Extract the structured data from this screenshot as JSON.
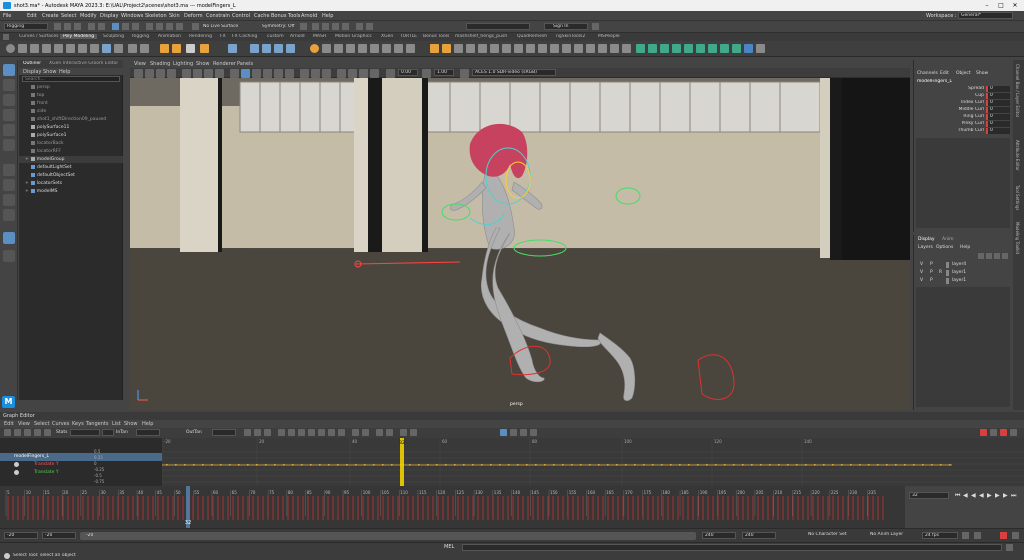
{
  "window": {
    "title": "shot3.ma* - Autodesk MAYA 2023.3: E:\\UAL\\Project2\\scenes\\shot3.ma   ---   modelFingers_L"
  },
  "menus": [
    "File",
    "Edit",
    "Create",
    "Select",
    "Modify",
    "Display",
    "Windows",
    "Skeleton",
    "Skin",
    "Deform",
    "Constrain",
    "Control",
    "Cache",
    "Bonus Tools",
    "Arnold",
    "Help"
  ],
  "status": {
    "mode": "Rigging",
    "live_surface": "No Live Surface",
    "symmetry": "Symmetry: Off",
    "sign_in": "Sign In",
    "workspace_label": "Workspace :",
    "workspace": "General*"
  },
  "shelf_tabs": [
    "Curves / Surfaces",
    "Poly Modeling",
    "Sculpting",
    "Rigging",
    "Animation",
    "Rendering",
    "FX",
    "FX Caching",
    "custom",
    "Arnold",
    "MASH",
    "Motion Graphics",
    "XGen",
    "TURTLE",
    "Bonus Tools",
    "mashshelf_hengs_push",
    "QuadRemesh",
    "ngSkinTools2",
    "MSPeople"
  ],
  "shelf_active": "Poly Modeling",
  "outliner": {
    "tabs": [
      "Outliner",
      "XGen Interactive Groom Editor"
    ],
    "menu": [
      "Display",
      "Show",
      "Help"
    ],
    "search_placeholder": "Search...",
    "items": [
      {
        "label": "persp"
      },
      {
        "label": "top"
      },
      {
        "label": "front"
      },
      {
        "label": "side"
      },
      {
        "label": "shot1_shiftDirection09_paused"
      },
      {
        "label": "polySurface11"
      },
      {
        "label": "polySurface1"
      },
      {
        "label": "locatorBack"
      },
      {
        "label": "locatorRFF"
      },
      {
        "label": "modelGroup"
      },
      {
        "label": "defaultLightSet"
      },
      {
        "label": "defaultObjectSet"
      },
      {
        "label": "locatorSets"
      },
      {
        "label": "modelMS"
      }
    ]
  },
  "viewport": {
    "menu": [
      "View",
      "Shading",
      "Lighting",
      "Show",
      "Renderer",
      "Panels"
    ],
    "field_a": "0.00",
    "field_b": "1.00",
    "colorspace": "ACES 1.0 SDR-video (sRGB)",
    "camera_label": "persp"
  },
  "channelbox": {
    "tabs": [
      "Channels",
      "Edit",
      "Object",
      "Show"
    ],
    "node": "modelFingers_L",
    "attributes": [
      {
        "name": "Spread",
        "value": "0"
      },
      {
        "name": "Cup",
        "value": "0"
      },
      {
        "name": "Index Curl",
        "value": "0"
      },
      {
        "name": "Middle Curl",
        "value": "0"
      },
      {
        "name": "Ring Curl",
        "value": "0"
      },
      {
        "name": "Pinky Curl",
        "value": "0"
      },
      {
        "name": "Thumb Curl",
        "value": "0"
      }
    ]
  },
  "layers": {
    "tabs": [
      "Display",
      "Anim"
    ],
    "menu": [
      "Layers",
      "Options",
      "Help"
    ],
    "items": [
      {
        "v": "V",
        "p": "P",
        "name": "layer4"
      },
      {
        "v": "V",
        "p": "P",
        "r": "R",
        "name": "layer1"
      },
      {
        "v": "V",
        "p": "P",
        "name": "layer1"
      }
    ]
  },
  "side_tabs": [
    "Channel Box / Layer Editor",
    "Attribute Editor",
    "Tool Settings",
    "Modeling Toolkit"
  ],
  "graph_editor": {
    "title": "Graph Editor",
    "menu": [
      "Edit",
      "View",
      "Select",
      "Curves",
      "Keys",
      "Tangents",
      "List",
      "Show",
      "Help"
    ],
    "stats_label": "Stats",
    "infinity": "InTan",
    "outtan": "OutTan",
    "outliner_items": [
      {
        "label": "modelFingers_L",
        "color": "#6fa8dc"
      },
      {
        "label": "Translate Y",
        "color": "#ff5555"
      },
      {
        "label": "Translate Y",
        "color": "#55cc55"
      }
    ],
    "y_ticks": [
      "0.5",
      "0.25",
      "0",
      "-0.25",
      "-0.5",
      "-0.75"
    ],
    "x_ticks": [
      "-20",
      "20",
      "40",
      "60",
      "80",
      "100",
      "120",
      "140"
    ],
    "current_frame": "32"
  },
  "timeline": {
    "ticks": [
      "5",
      "10",
      "15",
      "20",
      "25",
      "30",
      "35",
      "40",
      "45",
      "50",
      "55",
      "60",
      "65",
      "70",
      "75",
      "80",
      "85",
      "90",
      "95",
      "100",
      "105",
      "110",
      "115",
      "120",
      "125",
      "130",
      "135",
      "140",
      "145",
      "150",
      "155",
      "160",
      "165",
      "170",
      "175",
      "180",
      "185",
      "190",
      "195",
      "200",
      "205",
      "210",
      "215",
      "220",
      "225",
      "230",
      "235"
    ],
    "current_frame": "32",
    "current_field": "32"
  },
  "range": {
    "start": "-20",
    "start_inner": "-20",
    "end_inner": "240",
    "end": "240",
    "range_start_label": "-20",
    "character": "No Character Set",
    "anim_layer": "No Anim Layer",
    "fps": "24 fps"
  },
  "cmdline": {
    "lang": "MEL",
    "help": "Select Tool: select an object"
  },
  "colors": {
    "accent": "#5b8fc4",
    "key_red": "#e03030",
    "current_time": "#f0d000",
    "maya_blue": "#1b8ee0"
  }
}
